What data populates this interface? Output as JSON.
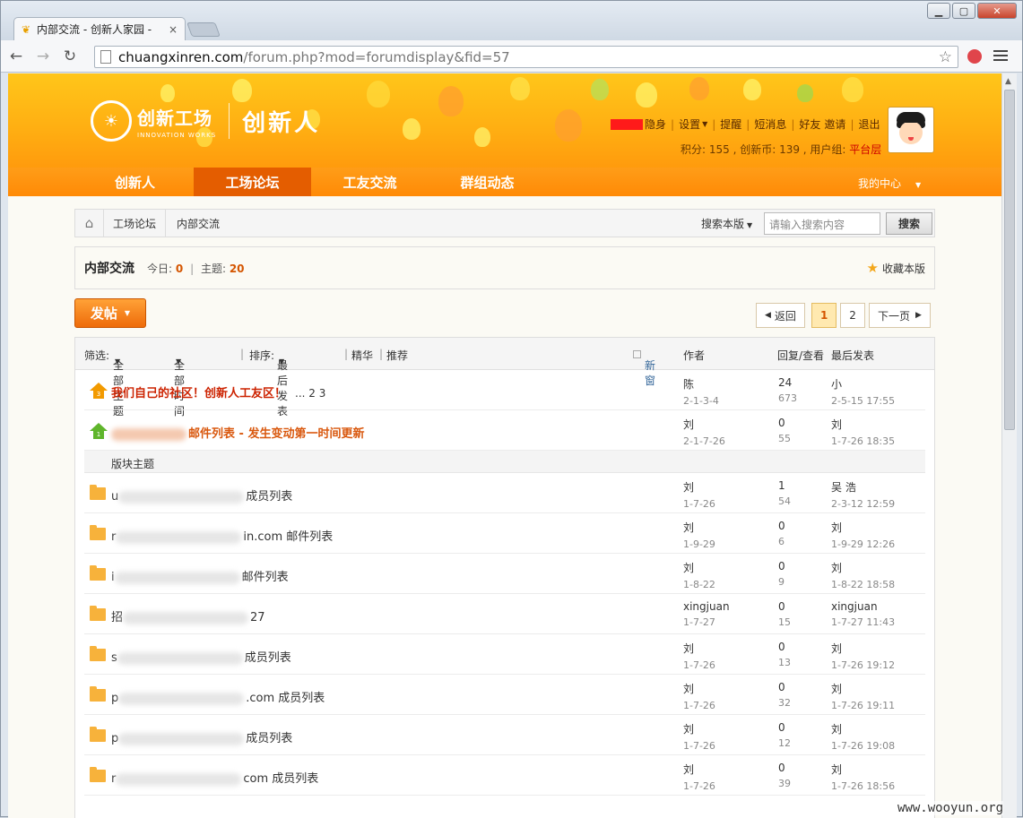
{
  "browser": {
    "tab_title": "内部交流 - 创新人家园 - ",
    "url_host": "chuangxinren.com",
    "url_path": "/forum.php?mod=forumdisplay&fid=57"
  },
  "header": {
    "logo_cn": "创新工场",
    "logo_en": "INNOVATION WORKS",
    "logo_big": "创新人",
    "user_links": [
      "隐身",
      "设置",
      "提醒",
      "短消息",
      "好友",
      "邀请",
      "退出"
    ],
    "credits_prefix": "积分: 155 , 创新币: 139 , 用户组: ",
    "user_group": "平台层"
  },
  "nav": {
    "items": [
      "创新人",
      "工场论坛",
      "工友交流",
      "群组动态"
    ],
    "active": "工场论坛",
    "my_center": "我的中心"
  },
  "breadcrumb": {
    "items": [
      "工场论坛",
      "内部交流"
    ],
    "search_scope": "搜索本版",
    "search_placeholder": "请输入搜索内容",
    "search_button": "搜索"
  },
  "forum": {
    "name": "内部交流",
    "today_label": "今日:",
    "today": "0",
    "topics_label": "主题:",
    "topics": "20",
    "favorite": "收藏本版"
  },
  "actions": {
    "post": "发帖",
    "pager": {
      "back": "返回",
      "pages": [
        "1",
        "2"
      ],
      "current": "1",
      "next": "下一页"
    }
  },
  "thread_header": {
    "filter": "筛选:",
    "all_topics": "全部主题",
    "all_time": "全部时间",
    "sort": "排序:",
    "sort_value": "最后发表",
    "digest": "精华",
    "recommend": "推荐",
    "new_window": "新窗",
    "author": "作者",
    "replies": "回复/查看",
    "last_post": "最后发表"
  },
  "section_label": "版块主题",
  "threads_sticky": [
    {
      "title": "我们自己的社区！创新人工友区！",
      "pages": "... 2  3",
      "author": "陈",
      "date": "2-1-3-4",
      "replies": "24",
      "views": "673",
      "last_author": "小",
      "last_time": "2-5-15 17:55"
    },
    {
      "title": "邮件列表 - 发生变动第一时间更新",
      "author": "刘",
      "date": "2-1-7-26",
      "replies": "0",
      "views": "55",
      "last_author": "刘",
      "last_time": "1-7-26 18:35"
    }
  ],
  "threads": [
    {
      "prefix": "u",
      "title": "成员列表",
      "author": "刘",
      "date": "1-7-26",
      "replies": "1",
      "views": "54",
      "last_author": "吴 浩",
      "last_time": "2-3-12 12:59"
    },
    {
      "prefix": "r",
      "title": "in.com 邮件列表",
      "author": "刘",
      "date": "1-9-29",
      "replies": "0",
      "views": "6",
      "last_author": "刘",
      "last_time": "1-9-29 12:26"
    },
    {
      "prefix": "i",
      "title": "邮件列表",
      "author": "刘",
      "date": "1-8-22",
      "replies": "0",
      "views": "9",
      "last_author": "刘",
      "last_time": "1-8-22 18:58"
    },
    {
      "prefix": "招",
      "title": "27",
      "author": "xingjuan",
      "date": "1-7-27",
      "replies": "0",
      "views": "15",
      "last_author": "xingjuan",
      "last_time": "1-7-27 11:43"
    },
    {
      "prefix": "s",
      "title": "成员列表",
      "author": "刘",
      "date": "1-7-26",
      "replies": "0",
      "views": "13",
      "last_author": "刘",
      "last_time": "1-7-26 19:12"
    },
    {
      "prefix": "p",
      "title": ".com 成员列表",
      "author": "刘",
      "date": "1-7-26",
      "replies": "0",
      "views": "32",
      "last_author": "刘",
      "last_time": "1-7-26 19:11"
    },
    {
      "prefix": "p",
      "title": "成员列表",
      "author": "刘",
      "date": "1-7-26",
      "replies": "0",
      "views": "12",
      "last_author": "刘",
      "last_time": "1-7-26 19:08"
    },
    {
      "prefix": "r",
      "title": "com 成员列表",
      "author": "刘",
      "date": "1-7-26",
      "replies": "0",
      "views": "39",
      "last_author": "刘",
      "last_time": "1-7-26 18:56"
    }
  ],
  "watermark": "www.wooyun.org"
}
